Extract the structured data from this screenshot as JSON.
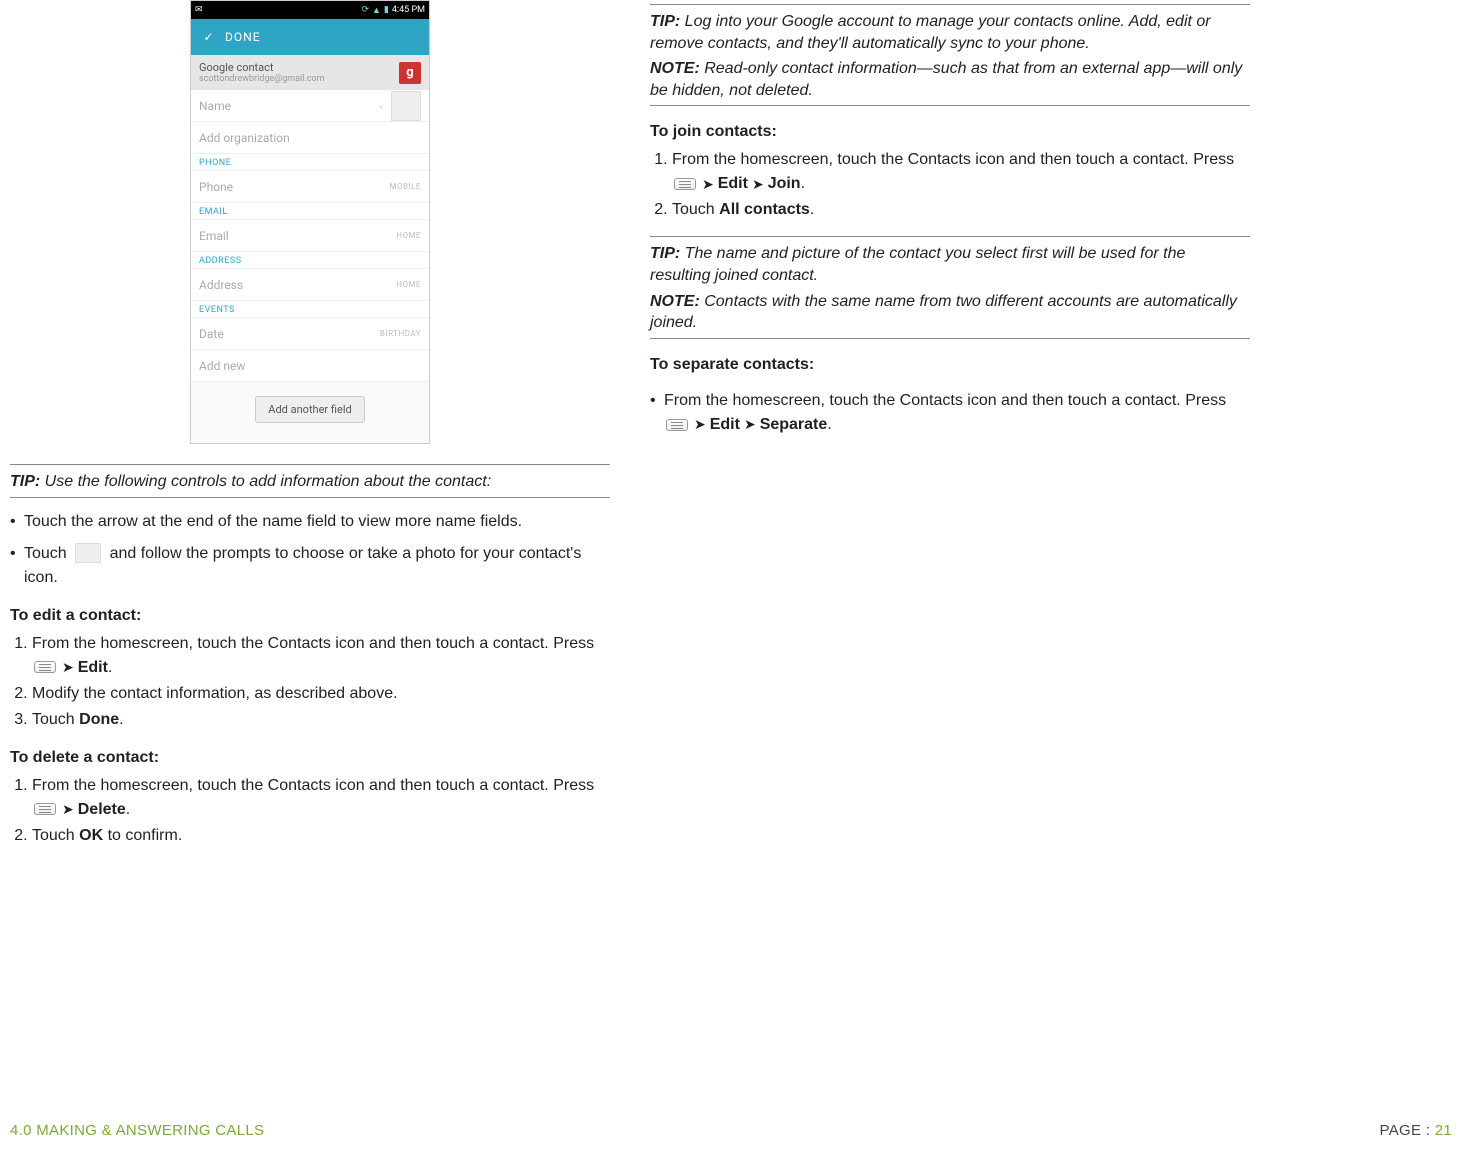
{
  "phone": {
    "status_time": "4:45 PM",
    "done": "DONE",
    "account_title": "Google contact",
    "account_email": "scottondrewbridge@gmail.com",
    "g": "g",
    "name_ph": "Name",
    "org_ph": "Add organization",
    "sec_phone": "PHONE",
    "phone_ph": "Phone",
    "phone_type": "MOBILE",
    "sec_email": "EMAIL",
    "email_ph": "Email",
    "email_type": "HOME",
    "sec_address": "ADDRESS",
    "address_ph": "Address",
    "address_type": "HOME",
    "sec_events": "EVENTS",
    "date_ph": "Date",
    "date_type": "BIRTHDAY",
    "addnew": "Add new",
    "add_another": "Add another field"
  },
  "left": {
    "tip1_label": "TIP:",
    "tip1": " Use the following controls to add information about the contact:",
    "b1": "Touch the arrow at the end of the name field to view more name fields.",
    "b2a": "Touch ",
    "b2b": " and follow the prompts to choose or take a photo for your contact's icon.",
    "h_edit": "To edit a contact:",
    "e1a": "From the homescreen, touch the Contacts icon and then touch a contact. Press ",
    "e1b": "Edit",
    "e2": "Modify the contact information, as described above.",
    "e3a": "Touch ",
    "e3b": "Done",
    "h_delete": "To delete a contact:",
    "d1a": "From the homescreen, touch the Contacts icon and then touch a contact. Press ",
    "d1b": "Delete",
    "d2a": "Touch ",
    "d2b": "OK",
    "d2c": " to confirm."
  },
  "right": {
    "tip2_label": "TIP:",
    "tip2": " Log into your Google account to manage your contacts online. Add, edit or remove contacts, and they'll automatically sync to your phone.",
    "note1_label": "NOTE:",
    "note1": " Read-only contact information—such as that from an external app—will only be hidden, not deleted.",
    "h_join": "To join contacts:",
    "j1a": "From the homescreen, touch the Contacts icon and then touch a contact. Press ",
    "j1b": "Edit",
    "j1c": "Join",
    "j2a": "Touch ",
    "j2b": "All contacts",
    "tip3_label": "TIP:",
    "tip3": " The name and picture of the contact you select first will be used for the resulting joined contact.",
    "note2_label": "NOTE:",
    "note2": " Contacts with the same name from two different accounts are automatically joined.",
    "h_sep": "To separate contacts:",
    "s1a": "From the homescreen, touch the Contacts icon and then touch a contact. Press ",
    "s1b": "Edit",
    "s1c": "Separate"
  },
  "footer": {
    "section": "4.0 MAKING & ANSWERING CALLS",
    "page_prefix": "PAGE : ",
    "page_num": "21"
  }
}
